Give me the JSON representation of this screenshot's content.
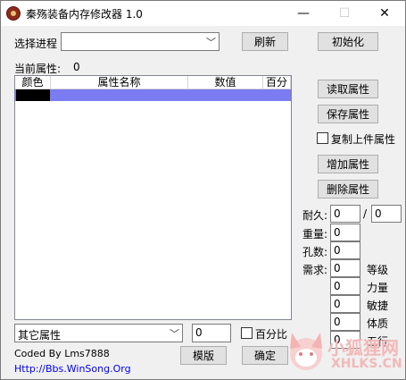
{
  "window": {
    "title": "秦殇装备内存修改器 1.0",
    "minimize": "—",
    "maximize": "☐",
    "close": "✕"
  },
  "process": {
    "label": "选择进程",
    "value": "",
    "refresh": "刷新",
    "init": "初始化"
  },
  "attr_count": {
    "label": "当前属性:",
    "value": "0"
  },
  "table": {
    "columns": [
      "颜色",
      "属性名称",
      "数值",
      "百分比"
    ]
  },
  "side_buttons": {
    "read": "读取属性",
    "save": "保存属性",
    "copy_prev": "复制上件属性",
    "add": "增加属性",
    "delete": "删除属性"
  },
  "stats": {
    "durability_label": "耐久:",
    "durability": "0",
    "slash": "/",
    "durability_max": "0",
    "weight_label": "重量:",
    "weight": "0",
    "holes_label": "孔数:",
    "holes": "0",
    "require_label": "需求:",
    "requirements": [
      {
        "label": "等级",
        "value": "0"
      },
      {
        "label": "力量",
        "value": "0"
      },
      {
        "label": "敏捷",
        "value": "0"
      },
      {
        "label": "体质",
        "value": "0"
      },
      {
        "label": "五行",
        "value": "0"
      }
    ]
  },
  "bottom": {
    "other_select": "其它属性",
    "value": "0",
    "percent": "百分比",
    "template": "模版",
    "ok": "确定"
  },
  "credits": {
    "coded_by": "Coded By Lms7888",
    "url": "Http://Bbs.WinSong.Org"
  },
  "watermark": {
    "cn": "小狐狸网",
    "en": "XHLKS.CN"
  },
  "colors": {
    "selection": "#7b7bf2",
    "link": "#0000ee",
    "watermark": "#f2b8b8"
  }
}
